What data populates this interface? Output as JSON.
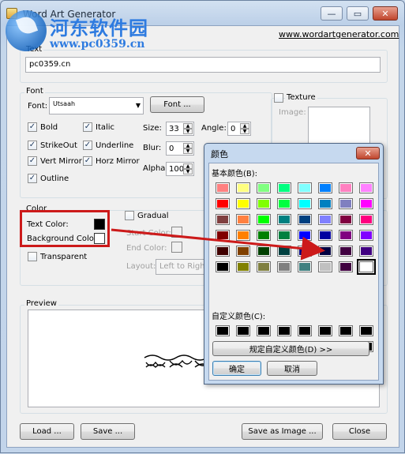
{
  "window": {
    "title": "Word Art Generator",
    "minimize_icon": "minimize-icon",
    "maximize_icon": "maximize-icon",
    "close_icon": "close-icon",
    "minimize_glyph": "—",
    "maximize_glyph": "▭",
    "close_glyph": "✕"
  },
  "watermark": {
    "title": "河东软件园",
    "url": "www.pc0359.cn"
  },
  "site_link": "www.wordartgenerator.com",
  "text_group": {
    "label": "Text",
    "value": "pc0359.cn"
  },
  "font_group": {
    "label": "Font",
    "font_label": "Font:",
    "font_value": "Utsaah",
    "font_button": "Font ...",
    "checkboxes": [
      {
        "label": "Bold",
        "checked": true
      },
      {
        "label": "Italic",
        "checked": true
      },
      {
        "label": "StrikeOut",
        "checked": true
      },
      {
        "label": "Underline",
        "checked": true
      },
      {
        "label": "Vert Mirror",
        "checked": true
      },
      {
        "label": "Horz Mirror",
        "checked": true
      },
      {
        "label": "Outline",
        "checked": true
      }
    ],
    "size_label": "Size:",
    "size_value": "33",
    "angle_label": "Angle:",
    "angle_value": "0",
    "blur_label": "Blur:",
    "blur_value": "0",
    "alpha_label": "Alpha:",
    "alpha_value": "100",
    "check_glyph": "✓"
  },
  "texture_group": {
    "label": "Texture",
    "image_label": "Image:"
  },
  "color_group": {
    "label": "Color",
    "text_color_label": "Text Color:",
    "text_color": "#000000",
    "background_color_label": "Background Color",
    "background_color": "#ffffff",
    "transparent_label": "Transparent",
    "gradual_label": "Gradual",
    "start_color_label": "Start Color:",
    "end_color_label": "End Color:",
    "layout_label": "Layout:",
    "layout_value": "Left to Right"
  },
  "preview_group": {
    "label": "Preview"
  },
  "buttons": {
    "load": "Load ...",
    "save": "Save ...",
    "save_as_image": "Save as Image ...",
    "close": "Close"
  },
  "color_dialog": {
    "title": "颜色",
    "close_glyph": "✕",
    "basic_colors_label": "基本颜色(B):",
    "basic_colors": [
      "#ff8080",
      "#ffff80",
      "#80ff80",
      "#00ff80",
      "#80ffff",
      "#0080ff",
      "#ff80c0",
      "#ff80ff",
      "#ff0000",
      "#ffff00",
      "#80ff00",
      "#00ff40",
      "#00ffff",
      "#0080c0",
      "#8080c0",
      "#ff00ff",
      "#804040",
      "#ff8040",
      "#00ff00",
      "#008080",
      "#004080",
      "#8080ff",
      "#800040",
      "#ff0080",
      "#800000",
      "#ff8000",
      "#008000",
      "#008040",
      "#0000ff",
      "#0000a0",
      "#800080",
      "#8000ff",
      "#400000",
      "#804000",
      "#004000",
      "#004040",
      "#000080",
      "#000040",
      "#400040",
      "#400080",
      "#000000",
      "#808000",
      "#808040",
      "#808080",
      "#408080",
      "#c0c0c0",
      "#400040",
      "#ffffff"
    ],
    "selected_index": 47,
    "custom_colors_label": "自定义颜色(C):",
    "custom_colors": [
      "#000000",
      "#000000",
      "#000000",
      "#000000",
      "#000000",
      "#000000",
      "#000000",
      "#000000",
      "#000000",
      "#000000",
      "#000000",
      "#000000",
      "#000000",
      "#000000",
      "#000000",
      "#000000"
    ],
    "define_custom_button": "规定自定义颜色(D) >>",
    "ok_button": "确定",
    "cancel_button": "取消"
  },
  "annotation": {
    "highlight_color": "#cc1a1a"
  }
}
